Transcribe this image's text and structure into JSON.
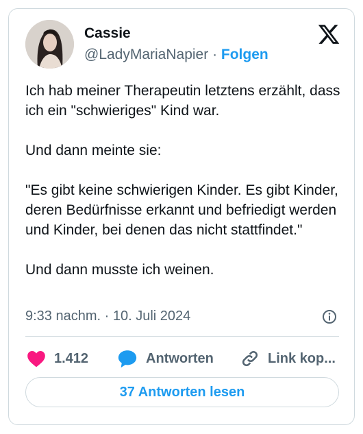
{
  "tweet": {
    "author_name": "Cassie",
    "handle": "@LadyMariaNapier",
    "separator": " · ",
    "follow_label": "Folgen",
    "paragraphs": [
      "Ich hab meiner Therapeutin letztens erzählt, dass ich ein \"schwieriges\" Kind war.",
      "Und dann meinte sie:",
      "\"Es gibt keine schwierigen Kinder. Es gibt Kinder, deren Bedürfnisse erkannt und befriedigt werden und Kinder, bei denen das nicht stattfindet.\"",
      "Und dann musste ich weinen."
    ],
    "timestamp": "9:33 nachm. · 10. Juli 2024"
  },
  "actions": {
    "like_count": "1.412",
    "reply_label": "Antworten",
    "copy_link_label": "Link kop..."
  },
  "read_replies_label": "37 Antworten lesen",
  "icons": {
    "logo": "x-logo-icon",
    "info": "info-icon",
    "like": "heart-icon",
    "reply": "speech-bubble-icon",
    "link": "link-icon"
  },
  "colors": {
    "accent": "#1d9bf0",
    "like": "#f91880",
    "text": "#0f1419",
    "muted": "#536471",
    "border": "#cfd9de"
  }
}
